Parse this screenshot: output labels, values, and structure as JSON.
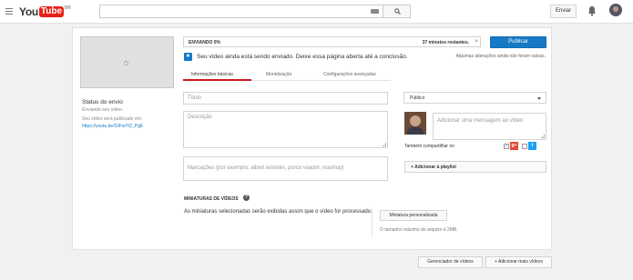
{
  "header": {
    "logo_you": "You",
    "logo_tube": "Tube",
    "logo_country": "BR",
    "search_placeholder": "",
    "upload_label": "Enviar"
  },
  "sidebar": {
    "status_title": "Status do envio",
    "status_text": "Enviando seu vídeo.",
    "publish_label": "Seu vídeo será publicado em:",
    "publish_link": "https://youtu.be/GIFwYt2_PgE"
  },
  "upload": {
    "progress_label": "ENVIANDO 0%",
    "progress_percent": 0,
    "remaining": "37 minutos restantes.",
    "close_glyph": "×",
    "publish_button": "Publicar",
    "notice": "Seu vídeo ainda está sendo enviado. Deixe essa página aberta até a conclusão.",
    "unsaved": "Algumas alterações ainda não foram salvas."
  },
  "tabs": [
    {
      "label": "Informações básicas",
      "active": true
    },
    {
      "label": "Monetização",
      "active": false
    },
    {
      "label": "Configurações avançadas",
      "active": false
    }
  ],
  "form": {
    "title_placeholder": "Título",
    "description_placeholder": "Descrição",
    "tags_placeholder": "Marcações (por exemplo, albert einstein, porco voador, mashup)",
    "privacy_value": "Público",
    "message_placeholder": "Adicionar uma mensagem ao vídeo",
    "share_label": "Também compartilhar no",
    "playlist_button": "+ Adicionar à playlist"
  },
  "thumbnails": {
    "title": "MINIATURAS DE VÍDEOS",
    "help_glyph": "?",
    "description": "As miniaturas selecionadas serão exibidas assim que o vídeo for processado.",
    "custom_button": "Miniatura personalizada",
    "max_size": "O tamanho máximo do arquivo é 2MB."
  },
  "footer": {
    "manager_button": "Gerenciador de vídeos",
    "add_more_button": "+ Adicionar mais vídeos"
  },
  "colors": {
    "brand_red": "#e62117",
    "primary_blue": "#167ac6"
  }
}
